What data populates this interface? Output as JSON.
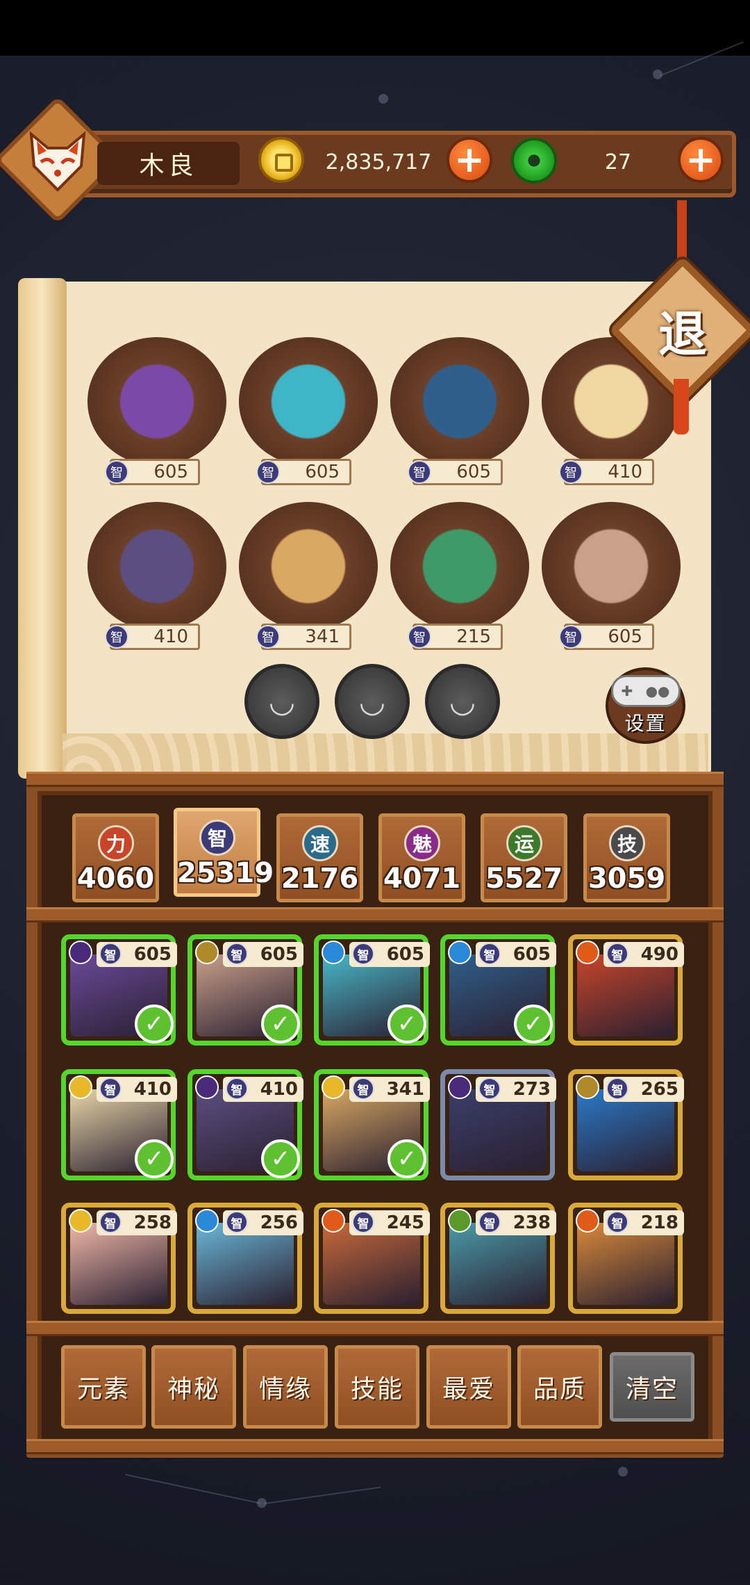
{
  "player": {
    "name": "木良"
  },
  "currency": {
    "coins": "2,835,717",
    "jade": "27"
  },
  "exit": {
    "label": "退"
  },
  "settings": {
    "label": "设置"
  },
  "team": [
    {
      "stat": "605",
      "stat_icon": "智",
      "color": "#7b4aa8"
    },
    {
      "stat": "605",
      "stat_icon": "智",
      "color": "#3fb6c8"
    },
    {
      "stat": "605",
      "stat_icon": "智",
      "color": "#2f5f8a"
    },
    {
      "stat": "410",
      "stat_icon": "智",
      "color": "#f0d9a0"
    },
    {
      "stat": "410",
      "stat_icon": "智",
      "color": "#5c4e80"
    },
    {
      "stat": "341",
      "stat_icon": "智",
      "color": "#d9a862"
    },
    {
      "stat": "215",
      "stat_icon": "智",
      "color": "#3f9a6a"
    },
    {
      "stat": "605",
      "stat_icon": "智",
      "color": "#c9a08a"
    }
  ],
  "empty_slots": [
    "bowl",
    "bowl",
    "bowl"
  ],
  "attributes": [
    {
      "icon": "力",
      "value": "4060",
      "color": "#c8452a",
      "active": false
    },
    {
      "icon": "智",
      "value": "25319",
      "color": "#3c3a78",
      "active": true
    },
    {
      "icon": "速",
      "value": "2176",
      "color": "#2a6a8a",
      "active": false
    },
    {
      "icon": "魅",
      "value": "4071",
      "color": "#8a2a8a",
      "active": false
    },
    {
      "icon": "运",
      "value": "5527",
      "color": "#3a7a2a",
      "active": false
    },
    {
      "icon": "技",
      "value": "3059",
      "color": "#4a4a4a",
      "active": false
    }
  ],
  "heroes": [
    {
      "stat": "605",
      "element": "#4a2a7a",
      "color": "#6a4a9a",
      "selected": true
    },
    {
      "stat": "605",
      "element": "#b08a2a",
      "color": "#c9a08a",
      "selected": true
    },
    {
      "stat": "605",
      "element": "#2a8ad8",
      "color": "#48b8c8",
      "selected": true
    },
    {
      "stat": "605",
      "element": "#2a8ad8",
      "color": "#2f5f8a",
      "selected": true
    },
    {
      "stat": "490",
      "element": "#e05a1a",
      "color": "#c8452a",
      "selected": false
    },
    {
      "stat": "410",
      "element": "#e8b82a",
      "color": "#e8d6a8",
      "selected": true
    },
    {
      "stat": "410",
      "element": "#4a2a7a",
      "color": "#5c4e80",
      "selected": true
    },
    {
      "stat": "341",
      "element": "#e8b82a",
      "color": "#d9a862",
      "selected": true
    },
    {
      "stat": "273",
      "element": "#4a2a7a",
      "color": "#3a3f6a",
      "selected": false
    },
    {
      "stat": "265",
      "element": "#b08a2a",
      "color": "#2a7ac8",
      "selected": false
    },
    {
      "stat": "258",
      "element": "#e8b82a",
      "color": "#f0b8a8",
      "selected": false
    },
    {
      "stat": "256",
      "element": "#2a8ad8",
      "color": "#6ab8d8",
      "selected": false
    },
    {
      "stat": "245",
      "element": "#e05a1a",
      "color": "#c86a3a",
      "selected": false
    },
    {
      "stat": "238",
      "element": "#5a9a2a",
      "color": "#4a9aa8",
      "selected": false
    },
    {
      "stat": "218",
      "element": "#e05a1a",
      "color": "#d88a3a",
      "selected": false
    }
  ],
  "hero_stat_icon": "智",
  "filters": [
    "元素",
    "神秘",
    "情缘",
    "技能",
    "最爱",
    "品质",
    "清空"
  ]
}
